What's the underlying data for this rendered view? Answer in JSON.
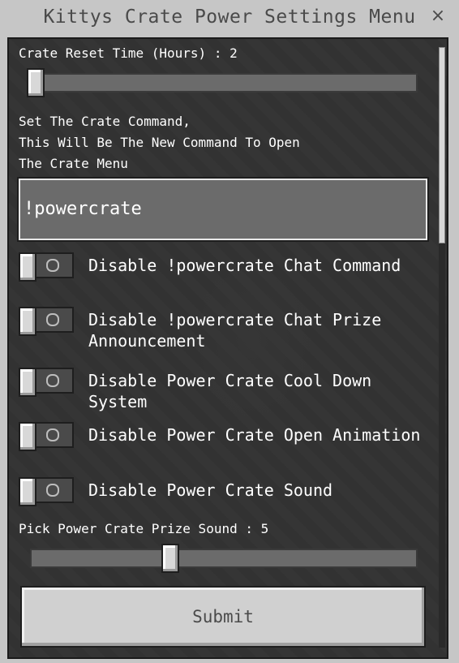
{
  "window": {
    "title": "Kittys Crate Power Settings Menu",
    "close_label": "×"
  },
  "reset_slider": {
    "label": "Crate Reset Time (Hours) : 2",
    "value": 2
  },
  "command": {
    "description_lines": [
      "Set The Crate Command,",
      "This Will Be The New Command To Open",
      "The Crate Menu"
    ],
    "value": "!powercrate"
  },
  "toggles": [
    {
      "label": "Disable !powercrate Chat Command",
      "state": "off"
    },
    {
      "label": "Disable !powercrate Chat Prize Announcement",
      "state": "off"
    },
    {
      "label": "Disable Power Crate Cool Down System",
      "state": "off"
    },
    {
      "label": "Disable Power Crate Open Animation",
      "state": "off"
    },
    {
      "label": "Disable Power Crate Sound",
      "state": "off"
    }
  ],
  "sound_slider": {
    "label": "Pick Power Crate Prize Sound : 5",
    "value": 5
  },
  "submit": {
    "label": "Submit"
  },
  "colors": {
    "panel_bg": "#303030",
    "frame": "#c6c6c6",
    "text": "#ffffff"
  }
}
